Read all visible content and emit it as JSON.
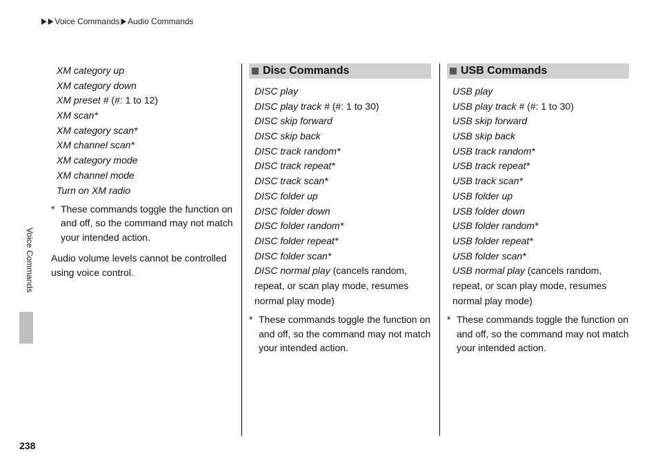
{
  "breadcrumb": {
    "level1": "Voice Commands",
    "level2": "Audio Commands"
  },
  "side_tab": "Voice Commands",
  "page_number": "238",
  "col1": {
    "commands": [
      {
        "text": "XM category up"
      },
      {
        "text": "XM category down"
      },
      {
        "text": "XM preset #",
        "paren": " (#: 1 to 12)"
      },
      {
        "text": "XM scan*"
      },
      {
        "text": "XM category scan*"
      },
      {
        "text": "XM channel scan*"
      },
      {
        "text": "XM category mode"
      },
      {
        "text": "XM channel mode"
      },
      {
        "text": "Turn on XM radio"
      }
    ],
    "note_ast": "*",
    "note": "These commands toggle the function on and off, so the command may not match your intended action.",
    "body": "Audio volume levels cannot be controlled using voice control."
  },
  "col2": {
    "header": "Disc Commands",
    "commands": [
      {
        "text": "DISC play"
      },
      {
        "text": "DISC play track #",
        "paren": " (#: 1 to 30)"
      },
      {
        "text": "DISC skip forward"
      },
      {
        "text": "DISC skip back"
      },
      {
        "text": "DISC track random*"
      },
      {
        "text": "DISC track repeat*"
      },
      {
        "text": "DISC track scan*"
      },
      {
        "text": "DISC folder up"
      },
      {
        "text": "DISC folder down"
      },
      {
        "text": "DISC folder random*"
      },
      {
        "text": "DISC folder repeat*"
      },
      {
        "text": "DISC folder scan*"
      },
      {
        "text": "DISC normal play",
        "desc": " (cancels random, repeat, or scan play mode, resumes normal play mode)"
      }
    ],
    "note_ast": "*",
    "note": "These commands toggle the function on and off, so the command may not match your intended action."
  },
  "col3": {
    "header": "USB Commands",
    "commands": [
      {
        "text": "USB play"
      },
      {
        "text": "USB play track #",
        "paren": " (#: 1 to 30)"
      },
      {
        "text": "USB skip forward"
      },
      {
        "text": "USB skip back"
      },
      {
        "text": "USB track random*"
      },
      {
        "text": "USB track repeat*"
      },
      {
        "text": "USB track scan*"
      },
      {
        "text": "USB folder up"
      },
      {
        "text": "USB folder down"
      },
      {
        "text": "USB folder random*"
      },
      {
        "text": "USB folder repeat*"
      },
      {
        "text": "USB folder scan*"
      },
      {
        "text": "USB normal play",
        "desc": " (cancels random, repeat, or scan play mode, resumes normal play mode)"
      }
    ],
    "note_ast": "*",
    "note": "These commands toggle the function on and off, so the command may not match your intended action."
  }
}
